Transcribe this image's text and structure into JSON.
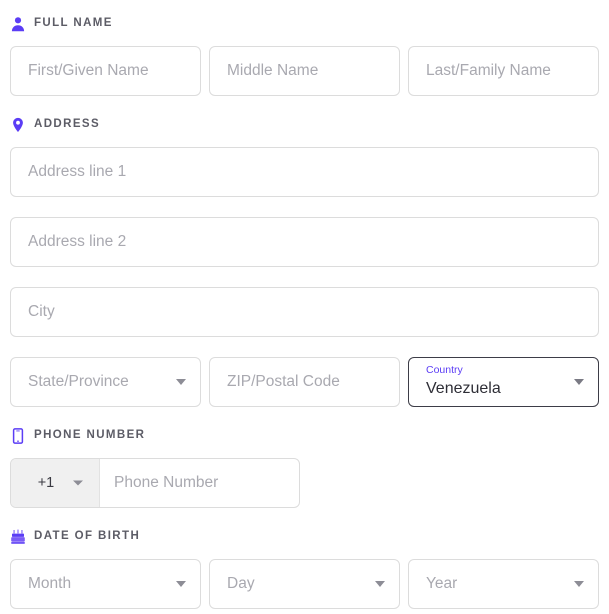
{
  "theme": {
    "accent": "#5b3df5",
    "header_text": "#5c5c66",
    "placeholder": "#a9a9b0",
    "border": "#dcdcdc",
    "border_filled": "#3d3d47",
    "value_text": "#2e2e36",
    "prefix_bg": "#f0f0f0",
    "page_bg": "#ffffff"
  },
  "sections": {
    "full_name": {
      "title": "FULL NAME",
      "icon": "person-icon",
      "fields": {
        "first": {
          "placeholder": "First/Given Name",
          "value": ""
        },
        "middle": {
          "placeholder": "Middle Name",
          "value": ""
        },
        "last": {
          "placeholder": "Last/Family Name",
          "value": ""
        }
      }
    },
    "address": {
      "title": "ADDRESS",
      "icon": "location-pin-icon",
      "fields": {
        "line1": {
          "placeholder": "Address line 1",
          "value": ""
        },
        "line2": {
          "placeholder": "Address line 2",
          "value": ""
        },
        "city": {
          "placeholder": "City",
          "value": ""
        },
        "state": {
          "placeholder": "State/Province",
          "value": ""
        },
        "zip": {
          "placeholder": "ZIP/Postal Code",
          "value": ""
        },
        "country": {
          "label": "Country",
          "value": "Venezuela"
        }
      }
    },
    "phone": {
      "title": "PHONE NUMBER",
      "icon": "smartphone-icon",
      "fields": {
        "country_code": {
          "value": "+1"
        },
        "number": {
          "placeholder": "Phone Number",
          "value": ""
        }
      }
    },
    "date_of_birth": {
      "title": "DATE OF BIRTH",
      "icon": "birthday-cake-icon",
      "fields": {
        "month": {
          "placeholder": "Month",
          "value": ""
        },
        "day": {
          "placeholder": "Day",
          "value": ""
        },
        "year": {
          "placeholder": "Year",
          "value": ""
        }
      }
    }
  }
}
